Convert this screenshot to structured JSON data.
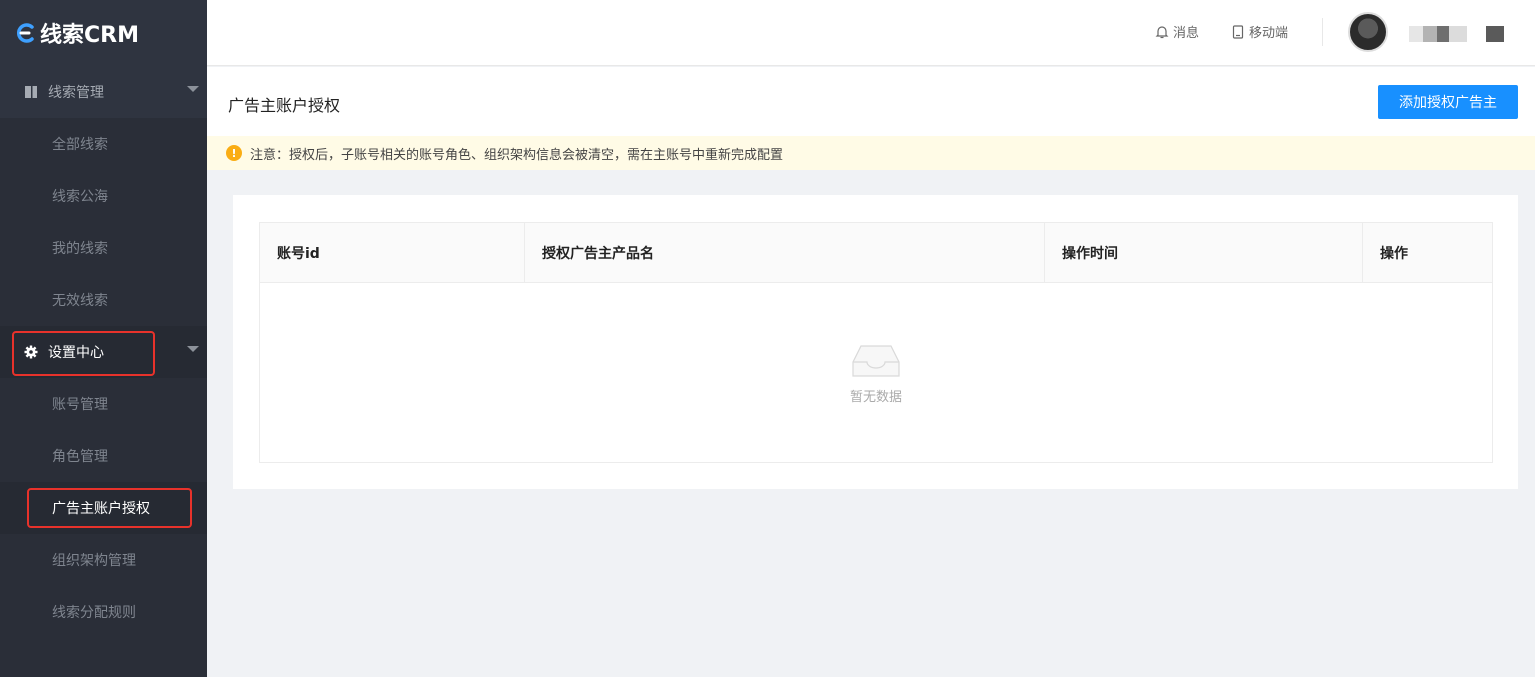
{
  "app": {
    "logo_text": "线索CRM"
  },
  "sidebar": {
    "groups": [
      {
        "label": "线索管理",
        "icon": "book-icon",
        "items": [
          "全部线索",
          "线索公海",
          "我的线索",
          "无效线索"
        ]
      },
      {
        "label": "设置中心",
        "icon": "gear-icon",
        "items": [
          "账号管理",
          "角色管理",
          "广告主账户授权",
          "组织架构管理",
          "线索分配规则"
        ]
      }
    ],
    "selected_item": "广告主账户授权"
  },
  "header": {
    "messages_label": "消息",
    "mobile_label": "移动端"
  },
  "page": {
    "title": "广告主账户授权",
    "add_button_label": "添加授权广告主",
    "notice": "注意：授权后，子账号相关的账号角色、组织架构信息会被清空，需在主账号中重新完成配置"
  },
  "table": {
    "columns": [
      "账号id",
      "授权广告主产品名",
      "操作时间",
      "操作"
    ],
    "rows": [],
    "empty_text": "暂无数据"
  },
  "colors": {
    "sidebar_bg": "#2f3440",
    "primary": "#1890ff",
    "highlight_box": "#e8322b",
    "warning": "#faad14"
  }
}
